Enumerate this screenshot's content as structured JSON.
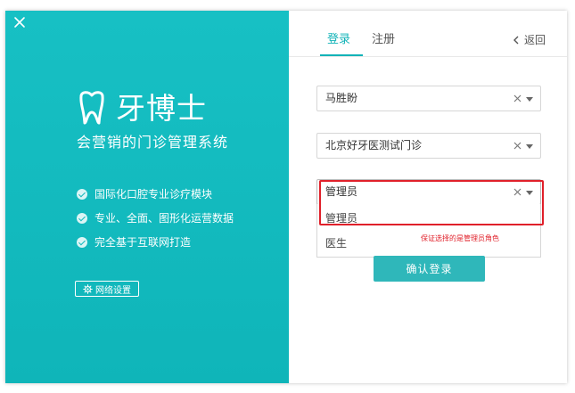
{
  "window": {
    "close_icon": "close-icon"
  },
  "brand": {
    "logo_icon": "tooth-logo-icon",
    "name": "牙博士",
    "tagline": "会营销的门诊管理系统"
  },
  "features": [
    {
      "label": "国际化口腔专业诊疗模块",
      "icon": "check-circle-icon"
    },
    {
      "label": "专业、全面、图形化运营数据",
      "icon": "check-circle-icon"
    },
    {
      "label": "完全基于互联网打造",
      "icon": "check-circle-icon"
    }
  ],
  "network_settings": {
    "label": "网络设置",
    "icon": "gear-icon"
  },
  "tabs": {
    "login": "登录",
    "register": "注册"
  },
  "back": {
    "label": "返回",
    "icon": "chevron-left-icon"
  },
  "form": {
    "user": "马胜盼",
    "clinic": "北京好牙医测试门诊",
    "role": "管理员",
    "role_options": [
      "管理员",
      "医生"
    ]
  },
  "annotation": "保证选择的是管理员角色",
  "confirm_button": "确认登录",
  "colors": {
    "brand_teal": "#12b3b8",
    "button_teal": "#2fb7ba",
    "highlight_red": "#e0202a"
  }
}
